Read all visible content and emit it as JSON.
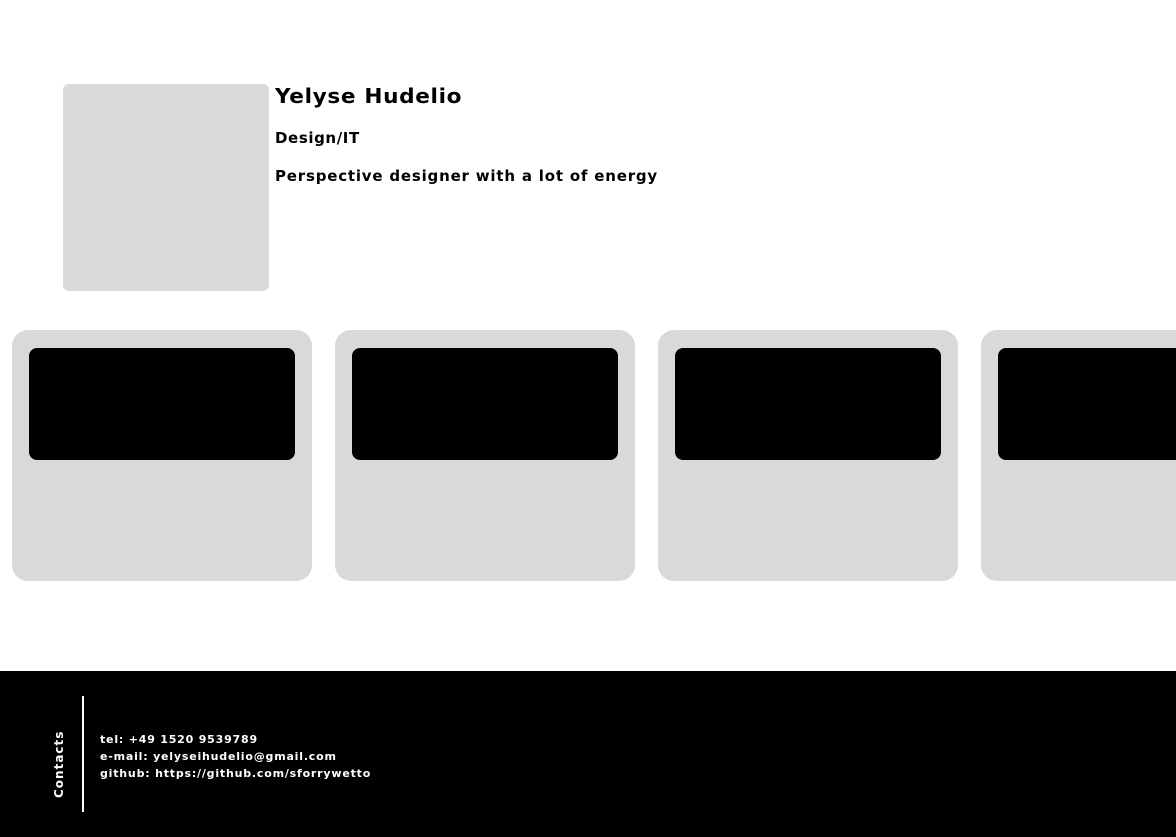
{
  "profile": {
    "name": "Yelyse Hudelio",
    "role": "Design/IT",
    "tagline": "Perspective designer with a lot of energy"
  },
  "projects": {
    "cards": [
      {
        "id": 1
      },
      {
        "id": 2
      },
      {
        "id": 3
      },
      {
        "id": 4
      }
    ]
  },
  "footer": {
    "heading": "Contacts",
    "tel": "tel: +49 1520 9539789",
    "email": "e-mail: yelyseihudelio@gmail.com",
    "github": "github: https://github.com/sforrywetto"
  },
  "colors": {
    "background": "#ffffff",
    "card": "#d9d9d9",
    "card_image": "#000000",
    "footer": "#000000",
    "footer_text": "#ffffff"
  }
}
